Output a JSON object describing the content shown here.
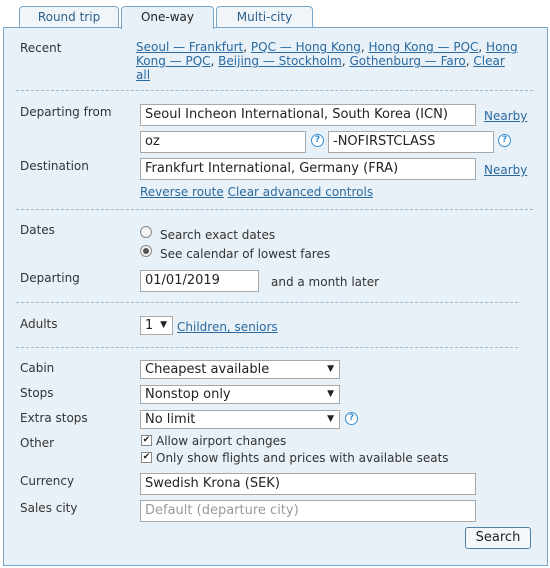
{
  "tabs": [
    "Round trip",
    "One-way",
    "Multi-city"
  ],
  "recent": {
    "label": "Recent",
    "line1": [
      "Seoul — Frankfurt",
      "PQC — Hong Kong",
      "Hong Kong — PQC",
      "Hong"
    ],
    "line2": [
      "Kong — PQC",
      "Beijing — Stockholm",
      "Gothenburg — Faro",
      "Clear"
    ],
    "line3": [
      "all"
    ]
  },
  "departing_from": {
    "label": "Departing from",
    "value": "Seoul Incheon International, South Korea (ICN)",
    "nearby": "Nearby",
    "routing_code": "oz",
    "extension_code": "-NOFIRSTCLASS"
  },
  "destination": {
    "label": "Destination",
    "value": "Frankfurt International, Germany (FRA)",
    "nearby": "Nearby",
    "reverse_route": "Reverse route",
    "clear_advanced": "Clear advanced controls"
  },
  "dates": {
    "label": "Dates",
    "option_exact": "Search exact dates",
    "option_calendar": "See calendar of lowest fares",
    "selected": "calendar",
    "departing_label": "Departing",
    "departing_value": "01/01/2019",
    "departing_suffix": "and a month later"
  },
  "adults": {
    "label": "Adults",
    "value": "1",
    "children_link": "Children, seniors"
  },
  "cabin": {
    "label": "Cabin",
    "value": "Cheapest available"
  },
  "stops": {
    "label": "Stops",
    "value": "Nonstop only"
  },
  "extra_stops": {
    "label": "Extra stops",
    "value": "No limit"
  },
  "other": {
    "label": "Other",
    "allow_airport_changes": "Allow airport changes",
    "allow_airport_changes_checked": true,
    "only_available": "Only show flights and prices with available seats",
    "only_available_checked": true
  },
  "currency": {
    "label": "Currency",
    "value": "Swedish Krona (SEK)"
  },
  "sales_city": {
    "label": "Sales city",
    "placeholder": "Default (departure city)"
  },
  "search_button": "Search"
}
